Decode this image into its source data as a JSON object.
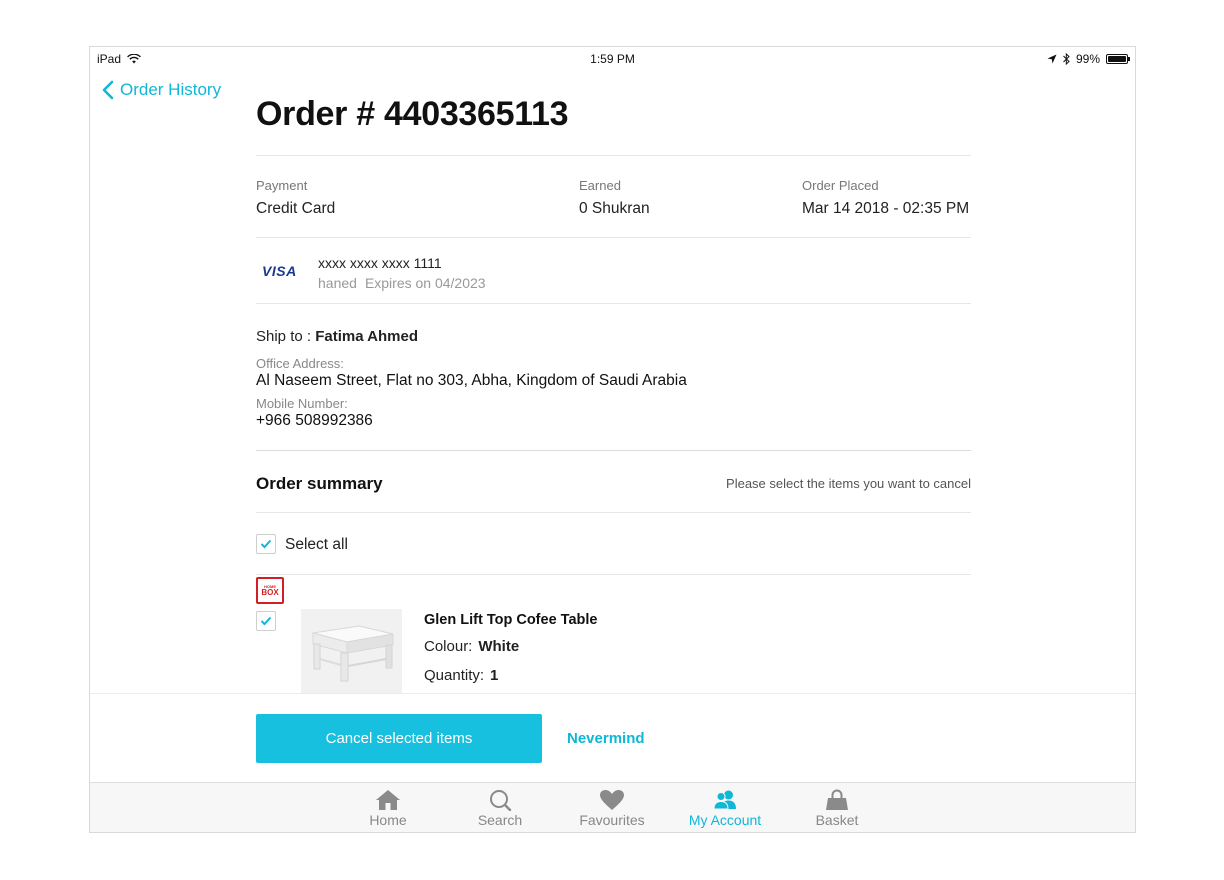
{
  "status_bar": {
    "device": "iPad",
    "time": "1:59 PM",
    "battery": "99%",
    "battery_level": 0.99
  },
  "nav": {
    "back_label": "Order History"
  },
  "order": {
    "title": "Order # 4403365113",
    "payment_label": "Payment",
    "payment_value": "Credit Card",
    "earned_label": "Earned",
    "earned_value": "0 Shukran",
    "placed_label": "Order Placed",
    "placed_value": "Mar 14 2018 - 02:35 PM"
  },
  "card": {
    "brand": "VISA",
    "number": "xxxx xxxx xxxx 1111",
    "holder": "haned",
    "expiry": "Expires on 04/2023"
  },
  "shipping": {
    "ship_to_label": "Ship to :",
    "name": "Fatima Ahmed",
    "address_label": "Office Address:",
    "address_value": "Al Naseem Street, Flat no 303, Abha, Kingdom of Saudi Arabia",
    "mobile_label": "Mobile Number:",
    "mobile_value": "+966 508992386"
  },
  "summary": {
    "title": "Order summary",
    "hint": "Please select the items you want to cancel",
    "select_all_label": "Select all",
    "select_all_checked": true
  },
  "items": [
    {
      "brand_line1": "HOME",
      "brand_line2": "BOX",
      "name": "Glen Lift Top Cofee Table",
      "colour_label": "Colour:",
      "colour_value": "White",
      "quantity_label": "Quantity:",
      "quantity_value": "1",
      "checked": true
    }
  ],
  "actions": {
    "cancel_label": "Cancel selected items",
    "nevermind_label": "Nevermind"
  },
  "tab_bar": {
    "tabs": [
      {
        "label": "Home",
        "icon": "home-icon",
        "active": false
      },
      {
        "label": "Search",
        "icon": "search-icon",
        "active": false
      },
      {
        "label": "Favourites",
        "icon": "heart-icon",
        "active": false
      },
      {
        "label": "My Account",
        "icon": "account-icon",
        "active": true
      },
      {
        "label": "Basket",
        "icon": "basket-icon",
        "active": false
      }
    ]
  },
  "colors": {
    "accent": "#17c0de",
    "link": "#10b7d6",
    "brand_red": "#d21f26"
  }
}
